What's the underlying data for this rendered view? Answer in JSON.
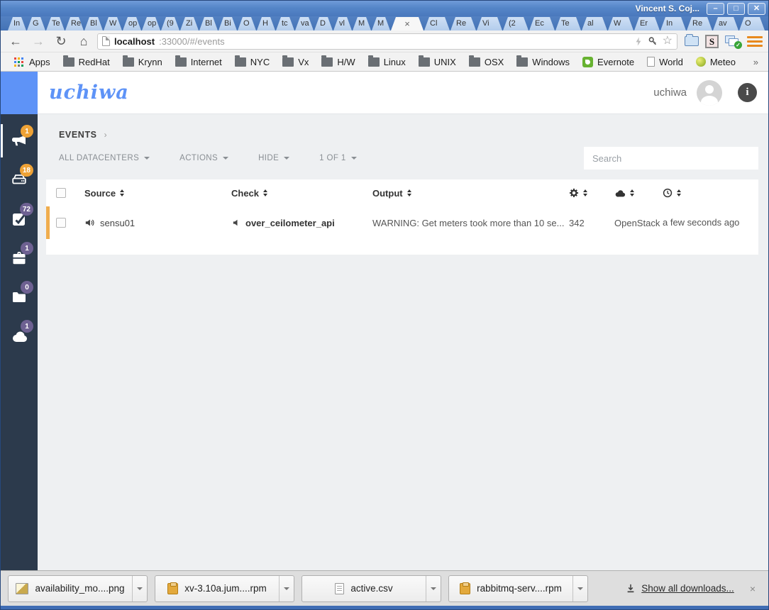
{
  "window": {
    "title": "Vincent S. Coj..."
  },
  "tabs": {
    "left": [
      "In",
      "G",
      "Te",
      "Re",
      "Bl",
      "W",
      "op",
      "op",
      "(9",
      "Zi",
      "Bl",
      "Bi",
      "O",
      "H",
      "tc",
      "va",
      "D",
      "vl",
      "M",
      "M"
    ],
    "active_close": "×",
    "right": [
      "Cl",
      "Re",
      "Vi",
      "(2",
      "Ec",
      "Te",
      "al",
      "W",
      "Er",
      "In",
      "Re",
      "av",
      "O"
    ]
  },
  "toolbar": {
    "back": "←",
    "forward": "→",
    "reload": "↻",
    "home": "⌂",
    "url_host": "localhost",
    "url_rest": ":33000/#/events",
    "bookmark_star": "☆",
    "extension_s": "S",
    "extension_check": "✓"
  },
  "bookmarks": {
    "items": [
      {
        "label": "Apps",
        "icon": "icon-apps"
      },
      {
        "label": "RedHat",
        "icon": "icon-folder"
      },
      {
        "label": "Krynn",
        "icon": "icon-folder"
      },
      {
        "label": "Internet",
        "icon": "icon-folder"
      },
      {
        "label": "NYC",
        "icon": "icon-folder"
      },
      {
        "label": "Vx",
        "icon": "icon-folder"
      },
      {
        "label": "H/W",
        "icon": "icon-folder"
      },
      {
        "label": "Linux",
        "icon": "icon-folder"
      },
      {
        "label": "UNIX",
        "icon": "icon-folder"
      },
      {
        "label": "OSX",
        "icon": "icon-folder"
      },
      {
        "label": "Windows",
        "icon": "icon-folder"
      },
      {
        "label": "Evernote",
        "icon": "icon-evernote"
      },
      {
        "label": "World",
        "icon": "icon-page"
      },
      {
        "label": "Meteo",
        "icon": "icon-globe"
      }
    ],
    "overflow": "»"
  },
  "app": {
    "logo": "uchiwa",
    "username": "uchiwa",
    "info_glyph": "i",
    "sidebar": [
      {
        "name": "events",
        "badge": "1",
        "color": "badge-orange"
      },
      {
        "name": "clients",
        "badge": "18",
        "color": "badge-orange"
      },
      {
        "name": "checks",
        "badge": "72",
        "color": "badge-purple"
      },
      {
        "name": "stashes",
        "badge": "1",
        "color": "badge-purple"
      },
      {
        "name": "aggregates",
        "badge": "0",
        "color": "badge-purple"
      },
      {
        "name": "datacenters",
        "badge": "1",
        "color": "badge-purple"
      }
    ],
    "breadcrumb": "EVENTS",
    "breadcrumb_chevron": "›",
    "filters": [
      "ALL DATACENTERS",
      "ACTIONS",
      "HIDE",
      "1 OF 1"
    ],
    "search_placeholder": "Search",
    "table": {
      "col_source": "Source",
      "col_check": "Check",
      "col_output": "Output",
      "row": {
        "source": "sensu01",
        "check": "over_ceilometer_api",
        "output": "WARNING: Get meters took more than 10 se...",
        "occurrences": "342",
        "datacenter": "OpenStack",
        "time": "a few seconds ago"
      }
    }
  },
  "downloads": {
    "items": [
      {
        "label": "availability_mo....png",
        "icon": "icon-image"
      },
      {
        "label": "xv-3.10a.jum....rpm",
        "icon": "icon-package"
      },
      {
        "label": "active.csv",
        "icon": "icon-doc"
      },
      {
        "label": "rabbitmq-serv....rpm",
        "icon": "icon-package"
      }
    ],
    "show_all": "Show all downloads...",
    "close": "×"
  },
  "colors": {
    "accent_blue": "#5e93f7",
    "sidebar_navy": "#2c3a4c",
    "warning_orange": "#f0ad4e",
    "badge_orange": "#eea236",
    "badge_purple": "#6e6192",
    "frame_blue": "#3f6db4"
  }
}
